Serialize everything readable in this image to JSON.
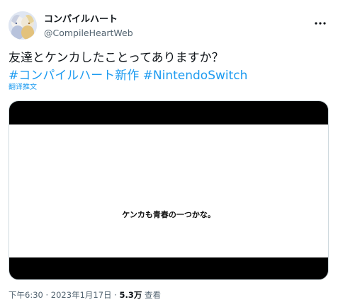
{
  "tweet": {
    "display_name": "コンパイルハート",
    "handle": "@CompileHeartWeb",
    "text_line1": "友達とケンカしたことってありますか？",
    "hashtags": [
      "#コンパイルハート新作",
      "#NintendoSwitch"
    ],
    "translate_label": "翻译推文",
    "media_caption": "ケンカも青春の一つかな。",
    "time": "下午6:30",
    "separator": "·",
    "date": "2023年1月17日",
    "views_count": "5.3万",
    "views_label": "查看"
  },
  "colors": {
    "link": "#1d9bf0",
    "text": "#0f1419",
    "secondary": "#536471"
  },
  "icons": {
    "more": "more-horizontal-icon"
  }
}
